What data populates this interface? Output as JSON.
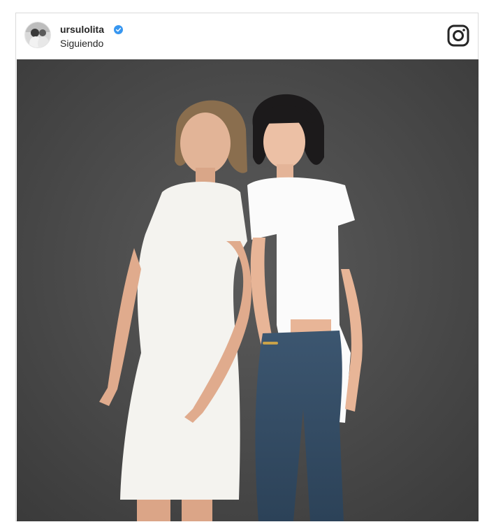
{
  "post": {
    "username": "ursulolita",
    "status": "Siguiendo",
    "verified_color": "#3897f0"
  },
  "icons": {
    "brand": "instagram-icon",
    "verified": "verified-badge-icon"
  }
}
